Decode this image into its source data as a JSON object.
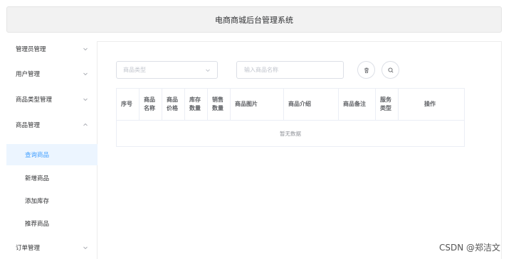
{
  "header": {
    "title": "电商商城后台管理系统"
  },
  "sidebar": {
    "menus": [
      {
        "label": "管理员管理",
        "chevron": "down"
      },
      {
        "label": "用户管理",
        "chevron": "down"
      },
      {
        "label": "商品类型管理",
        "chevron": "down"
      },
      {
        "label": "商品管理",
        "chevron": "up"
      }
    ],
    "sub_items": [
      {
        "label": "查询商品",
        "active": true
      },
      {
        "label": "新增商品",
        "active": false
      },
      {
        "label": "添加库存",
        "active": false
      },
      {
        "label": "推荐商品",
        "active": false
      }
    ],
    "order_menu": {
      "label": "订单管理",
      "chevron": "down"
    }
  },
  "filters": {
    "type_select": {
      "placeholder": "商品类型"
    },
    "name_input": {
      "placeholder": "输入商品名称"
    },
    "icons": {
      "clear": "trash-icon",
      "search": "search-icon"
    }
  },
  "table": {
    "columns": [
      [
        "序号"
      ],
      [
        "商品",
        "名称"
      ],
      [
        "商品",
        "价格"
      ],
      [
        "库存",
        "数量"
      ],
      [
        "销售",
        "数量"
      ],
      [
        "商品图片"
      ],
      [
        "商品介绍"
      ],
      [
        "商品备注"
      ],
      [
        "服务",
        "类型"
      ],
      [
        "操作"
      ]
    ],
    "empty_text": "暂无数据"
  },
  "watermark": "CSDN @郑洁文",
  "colors": {
    "accent": "#409eff",
    "active_bg": "#ecf5ff"
  }
}
